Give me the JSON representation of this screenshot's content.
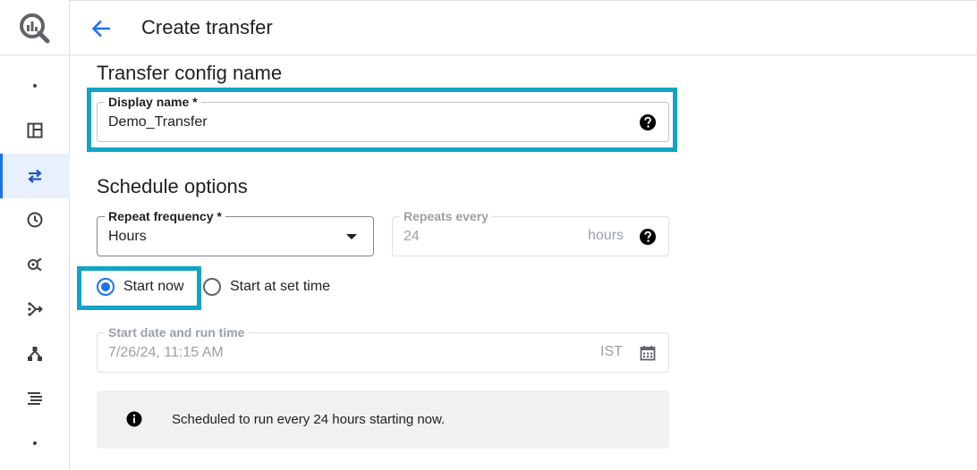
{
  "header": {
    "title": "Create transfer"
  },
  "sections": {
    "config_title": "Transfer config name",
    "schedule_title": "Schedule options"
  },
  "display_name": {
    "label": "Display name *",
    "value": "Demo_Transfer"
  },
  "repeat_frequency": {
    "label": "Repeat frequency *",
    "value": "Hours"
  },
  "repeats_every": {
    "label": "Repeats every",
    "value": "24",
    "unit": "hours"
  },
  "start_options": {
    "start_now": "Start now",
    "start_at_set_time": "Start at set time",
    "selected": "start_now"
  },
  "start_date": {
    "label": "Start date and run time",
    "value": "7/26/24, 11:15 AM",
    "timezone": "IST"
  },
  "info": {
    "message": "Scheduled to run every 24 hours starting now."
  },
  "colors": {
    "accent": "#1a73e8",
    "highlight": "#12a4c6",
    "info_bg": "#f1f1f1"
  },
  "icons": {
    "logo": "bigquery-logo-icon",
    "rail": [
      "dot-icon",
      "dashboard-icon",
      "transfers-icon",
      "history-icon",
      "analytics-hub-icon",
      "pipeline-icon",
      "hierarchy-icon",
      "list-icon",
      "dot-icon"
    ]
  }
}
